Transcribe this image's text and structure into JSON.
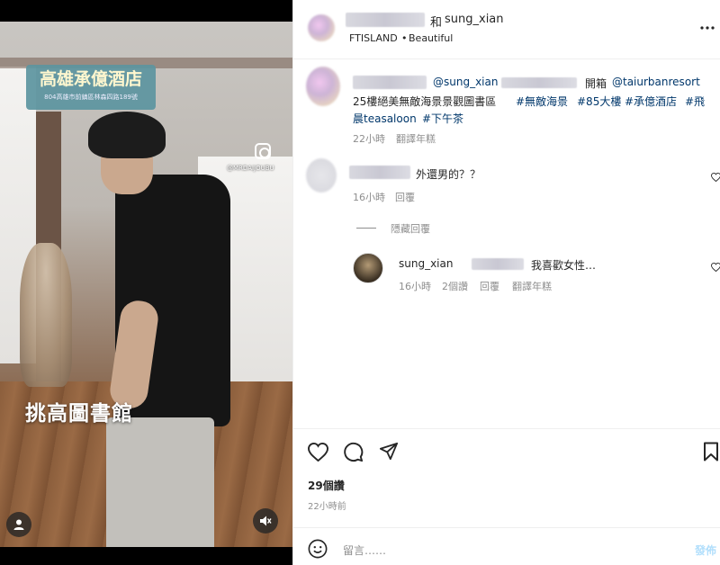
{
  "post_header": {
    "collab_joiner": "和",
    "collab_user": "sung_xian",
    "subtitle_left": "FTISLAND",
    "subtitle_sep": "•",
    "subtitle_right": "Beautiful",
    "more_icon": "more-horizontal-icon"
  },
  "media": {
    "hotel_sign_name": "高雄承億酒店",
    "hotel_sign_address": "804高雄市前鎮區林森四路189號",
    "watermark_handle": "@MRDAIJOUBU",
    "overlay_caption": "挑高圖書館",
    "user_tag_icon": "user-tag-icon",
    "mute_icon": "muted-speaker-icon"
  },
  "caption": {
    "mention_1": "@sung_xian",
    "text_1": "開箱",
    "mention_2": "@taiurbanresort",
    "line_2_text": "25樓絕美無敵海景景觀圖書區",
    "line_2_tags": [
      "#無敵海景",
      "#85大樓",
      "#承億酒店",
      "#飛"
    ],
    "line_3_tag_a": "晨teasaloon",
    "line_3_tag_b": "#下午茶",
    "time": "22小時",
    "translate": "翻譯年糕"
  },
  "comments": [
    {
      "text": "外還男的？？",
      "time": "16小時",
      "reply": "回覆",
      "hide_replies": "隱藏回覆"
    }
  ],
  "replies": [
    {
      "username": "sung_xian",
      "text": "我喜歡女性…",
      "time": "16小時",
      "likes": "2個讚",
      "reply": "回覆",
      "translate": "翻譯年糕"
    }
  ],
  "actions": {
    "like_icon": "heart-icon",
    "comment_icon": "comment-icon",
    "share_icon": "paper-plane-icon",
    "save_icon": "bookmark-icon",
    "likes_count": "29個讚",
    "posted_time": "22小時前"
  },
  "comment_box": {
    "emoji_icon": "emoji-icon",
    "placeholder": "留言……",
    "post_label": "發佈"
  },
  "colors": {
    "link": "#00376b",
    "meta": "#8e8e8e",
    "post_button": "#b2dffc",
    "hotel_sign_bg": "#5c95a0"
  }
}
